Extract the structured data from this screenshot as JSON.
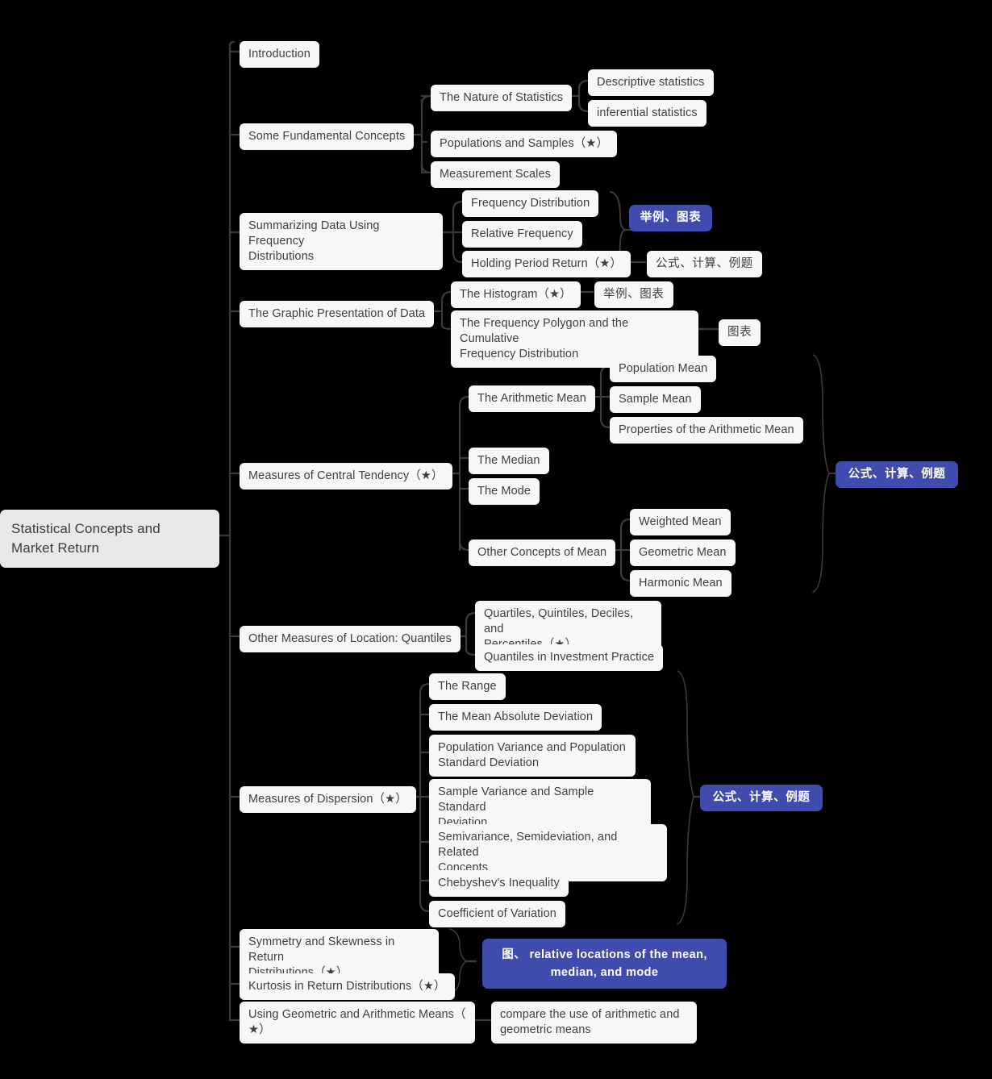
{
  "diagram": {
    "type": "mindmap",
    "title": "Statistical Concepts and Market Return",
    "background": "#000000",
    "node_color": "#f7f7f7",
    "root_color": "#e8e8e8",
    "accent_color": "#3f4bad",
    "text_color": "#3f3f3f"
  },
  "root": {
    "label": "Statistical Concepts and\nMarket Return"
  },
  "nodes": {
    "introduction": "Introduction",
    "some_fundamental_concepts": "Some Fundamental Concepts",
    "nature_of_statistics": "The Nature of Statistics",
    "descriptive_statistics": "Descriptive statistics",
    "inferential_statistics": "inferential statistics",
    "populations_and_samples": "Populations and Samples（★）",
    "measurement_scales": "Measurement Scales",
    "summarizing_data": "Summarizing Data Using Frequency\nDistributions",
    "frequency_distribution": "Frequency Distribution",
    "relative_frequency": "Relative Frequency",
    "holding_period_return": "Holding Period Return（★）",
    "badge_examples_charts_1": "举例、图表",
    "tag_formula_calc_problems_1": "公式、计算、例题",
    "graphic_presentation": "The Graphic Presentation of Data",
    "the_histogram": "The Histogram（★）",
    "tag_examples_charts_2": "举例、图表",
    "frequency_polygon": "The Frequency Polygon and the Cumulative\nFrequency Distribution",
    "tag_charts": "图表",
    "measures_central_tendency": "Measures of Central Tendency（★）",
    "arithmetic_mean": "The Arithmetic Mean",
    "population_mean": "Population Mean",
    "sample_mean": "Sample Mean",
    "properties_arithmetic_mean": "Properties of the Arithmetic Mean",
    "the_median": "The Median",
    "the_mode": "The Mode",
    "other_concepts_of_mean": "Other Concepts of Mean",
    "weighted_mean": "Weighted Mean",
    "geometric_mean": "Geometric Mean",
    "harmonic_mean": "Harmonic Mean",
    "badge_formula_calc_problems_2": "公式、计算、例题",
    "other_measures_location": "Other Measures of Location: Quantiles",
    "quartiles_quintiles": "Quartiles, Quintiles, Deciles, and\nPercentiles（★）",
    "quantiles_investment": "Quantiles in Investment Practice",
    "measures_of_dispersion": "Measures of Dispersion（★）",
    "the_range": "The Range",
    "mean_absolute_deviation": "The Mean Absolute Deviation",
    "population_variance": "Population Variance and Population\nStandard Deviation",
    "sample_variance": "Sample Variance and Sample Standard\nDeviation",
    "semivariance": "Semivariance, Semideviation, and Related\nConcepts",
    "chebyshevs_inequality": "Chebyshev's Inequality",
    "coefficient_of_variation": "Coefficient of Variation",
    "badge_formula_calc_problems_3": "公式、计算、例题",
    "symmetry_skewness": "Symmetry and Skewness in Return\nDistributions（★）",
    "kurtosis": "Kurtosis in Return Distributions（★）",
    "badge_relative_locations": "图、 relative locations of the mean,\nmedian, and mode",
    "using_geometric_arithmetic": "Using Geometric and Arithmetic Means（\n★）",
    "compare_use": "compare the use of arithmetic and\ngeometric means"
  }
}
